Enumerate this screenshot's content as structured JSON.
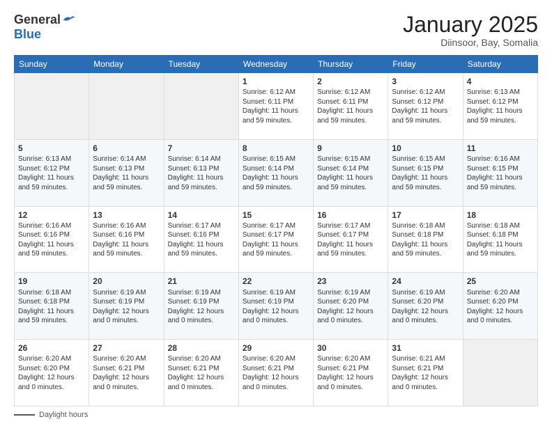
{
  "header": {
    "logo_general": "General",
    "logo_blue": "Blue",
    "title": "January 2025",
    "subtitle": "Diinsoor, Bay, Somalia"
  },
  "days_of_week": [
    "Sunday",
    "Monday",
    "Tuesday",
    "Wednesday",
    "Thursday",
    "Friday",
    "Saturday"
  ],
  "weeks": [
    [
      {
        "day": "",
        "empty": true
      },
      {
        "day": "",
        "empty": true
      },
      {
        "day": "",
        "empty": true
      },
      {
        "day": "1",
        "sunrise": "6:12 AM",
        "sunset": "6:11 PM",
        "daylight": "11 hours and 59 minutes."
      },
      {
        "day": "2",
        "sunrise": "6:12 AM",
        "sunset": "6:11 PM",
        "daylight": "11 hours and 59 minutes."
      },
      {
        "day": "3",
        "sunrise": "6:12 AM",
        "sunset": "6:12 PM",
        "daylight": "11 hours and 59 minutes."
      },
      {
        "day": "4",
        "sunrise": "6:13 AM",
        "sunset": "6:12 PM",
        "daylight": "11 hours and 59 minutes."
      }
    ],
    [
      {
        "day": "5",
        "sunrise": "6:13 AM",
        "sunset": "6:12 PM",
        "daylight": "11 hours and 59 minutes."
      },
      {
        "day": "6",
        "sunrise": "6:14 AM",
        "sunset": "6:13 PM",
        "daylight": "11 hours and 59 minutes."
      },
      {
        "day": "7",
        "sunrise": "6:14 AM",
        "sunset": "6:13 PM",
        "daylight": "11 hours and 59 minutes."
      },
      {
        "day": "8",
        "sunrise": "6:15 AM",
        "sunset": "6:14 PM",
        "daylight": "11 hours and 59 minutes."
      },
      {
        "day": "9",
        "sunrise": "6:15 AM",
        "sunset": "6:14 PM",
        "daylight": "11 hours and 59 minutes."
      },
      {
        "day": "10",
        "sunrise": "6:15 AM",
        "sunset": "6:15 PM",
        "daylight": "11 hours and 59 minutes."
      },
      {
        "day": "11",
        "sunrise": "6:16 AM",
        "sunset": "6:15 PM",
        "daylight": "11 hours and 59 minutes."
      }
    ],
    [
      {
        "day": "12",
        "sunrise": "6:16 AM",
        "sunset": "6:16 PM",
        "daylight": "11 hours and 59 minutes."
      },
      {
        "day": "13",
        "sunrise": "6:16 AM",
        "sunset": "6:16 PM",
        "daylight": "11 hours and 59 minutes."
      },
      {
        "day": "14",
        "sunrise": "6:17 AM",
        "sunset": "6:16 PM",
        "daylight": "11 hours and 59 minutes."
      },
      {
        "day": "15",
        "sunrise": "6:17 AM",
        "sunset": "6:17 PM",
        "daylight": "11 hours and 59 minutes."
      },
      {
        "day": "16",
        "sunrise": "6:17 AM",
        "sunset": "6:17 PM",
        "daylight": "11 hours and 59 minutes."
      },
      {
        "day": "17",
        "sunrise": "6:18 AM",
        "sunset": "6:18 PM",
        "daylight": "11 hours and 59 minutes."
      },
      {
        "day": "18",
        "sunrise": "6:18 AM",
        "sunset": "6:18 PM",
        "daylight": "11 hours and 59 minutes."
      }
    ],
    [
      {
        "day": "19",
        "sunrise": "6:18 AM",
        "sunset": "6:18 PM",
        "daylight": "11 hours and 59 minutes."
      },
      {
        "day": "20",
        "sunrise": "6:19 AM",
        "sunset": "6:19 PM",
        "daylight": "12 hours and 0 minutes."
      },
      {
        "day": "21",
        "sunrise": "6:19 AM",
        "sunset": "6:19 PM",
        "daylight": "12 hours and 0 minutes."
      },
      {
        "day": "22",
        "sunrise": "6:19 AM",
        "sunset": "6:19 PM",
        "daylight": "12 hours and 0 minutes."
      },
      {
        "day": "23",
        "sunrise": "6:19 AM",
        "sunset": "6:20 PM",
        "daylight": "12 hours and 0 minutes."
      },
      {
        "day": "24",
        "sunrise": "6:19 AM",
        "sunset": "6:20 PM",
        "daylight": "12 hours and 0 minutes."
      },
      {
        "day": "25",
        "sunrise": "6:20 AM",
        "sunset": "6:20 PM",
        "daylight": "12 hours and 0 minutes."
      }
    ],
    [
      {
        "day": "26",
        "sunrise": "6:20 AM",
        "sunset": "6:20 PM",
        "daylight": "12 hours and 0 minutes."
      },
      {
        "day": "27",
        "sunrise": "6:20 AM",
        "sunset": "6:21 PM",
        "daylight": "12 hours and 0 minutes."
      },
      {
        "day": "28",
        "sunrise": "6:20 AM",
        "sunset": "6:21 PM",
        "daylight": "12 hours and 0 minutes."
      },
      {
        "day": "29",
        "sunrise": "6:20 AM",
        "sunset": "6:21 PM",
        "daylight": "12 hours and 0 minutes."
      },
      {
        "day": "30",
        "sunrise": "6:20 AM",
        "sunset": "6:21 PM",
        "daylight": "12 hours and 0 minutes."
      },
      {
        "day": "31",
        "sunrise": "6:21 AM",
        "sunset": "6:21 PM",
        "daylight": "12 hours and 0 minutes."
      },
      {
        "day": "",
        "empty": true
      }
    ]
  ],
  "footer": {
    "label": "Daylight hours"
  }
}
